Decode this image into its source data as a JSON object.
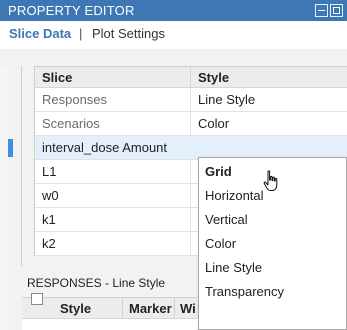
{
  "window": {
    "title": "PROPERTY EDITOR"
  },
  "tabs": [
    {
      "label": "Slice Data",
      "active": true
    },
    {
      "label": "Plot Settings",
      "active": false
    }
  ],
  "tab_separator": "|",
  "slice_table": {
    "headers": [
      "Slice",
      "Style"
    ],
    "rows": [
      {
        "slice": "Responses",
        "style": "Line Style"
      },
      {
        "slice": "Scenarios",
        "style": "Color"
      },
      {
        "slice": "interval_dose Amount",
        "style": ""
      },
      {
        "slice": "L1",
        "style": ""
      },
      {
        "slice": "w0",
        "style": ""
      },
      {
        "slice": "k1",
        "style": ""
      },
      {
        "slice": "k2",
        "style": ""
      }
    ]
  },
  "style_dropdown": {
    "options": [
      "Grid",
      "Horizontal",
      "Vertical",
      "Color",
      "Line Style",
      "Transparency"
    ],
    "hovered": "Grid"
  },
  "responses_section": {
    "label": "RESPONSES -  Line Style",
    "headers": [
      "Style",
      "Marker",
      "Wi"
    ]
  },
  "colors": {
    "titlebar": "#3d78b4",
    "accent": "#3c77b4",
    "selected_row": "#e3f0fb"
  }
}
